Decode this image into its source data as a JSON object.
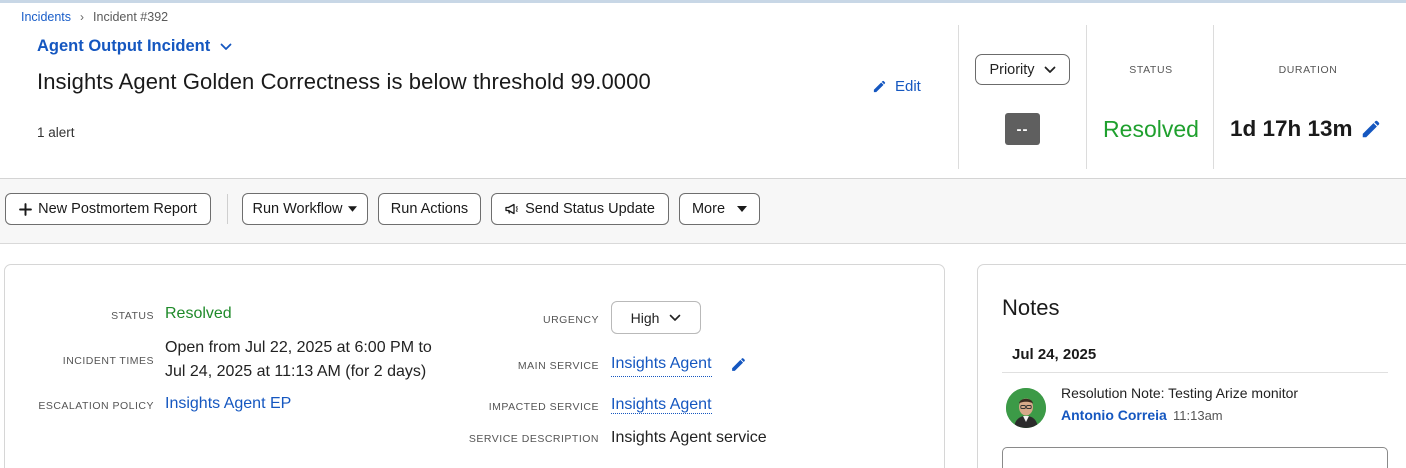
{
  "breadcrumb": {
    "root": "Incidents",
    "current": "Incident #392"
  },
  "incident": {
    "type": "Agent Output Incident",
    "title": "Insights Agent Golden Correctness is below threshold 99.0000",
    "alert_count": "1 alert",
    "edit_label": "Edit"
  },
  "stats": {
    "priority_label": "Priority",
    "priority_value": "--",
    "status_label": "STATUS",
    "status_value": "Resolved",
    "duration_label": "DURATION",
    "duration_value": "1d 17h 13m"
  },
  "toolbar": {
    "postmortem": "New Postmortem Report",
    "workflow": "Run Workflow",
    "actions": "Run Actions",
    "status_update": "Send Status Update",
    "more": "More"
  },
  "details": {
    "status_label": "STATUS",
    "status_value": "Resolved",
    "times_label": "INCIDENT TIMES",
    "times_line1": "Open from Jul 22, 2025 at 6:00 PM to",
    "times_line2": "Jul 24, 2025 at 11:13 AM (for 2 days)",
    "escalation_label": "ESCALATION POLICY",
    "escalation_value": "Insights Agent EP",
    "urgency_label": "URGENCY",
    "urgency_value": "High",
    "main_service_label": "MAIN SERVICE",
    "main_service_value": "Insights Agent",
    "impacted_label": "IMPACTED SERVICE",
    "impacted_value": "Insights Agent",
    "description_label": "SERVICE DESCRIPTION",
    "description_value": "Insights Agent service"
  },
  "notes": {
    "title": "Notes",
    "date": "Jul 24, 2025",
    "entries": [
      {
        "text": "Resolution Note: Testing Arize monitor",
        "author": "Antonio Correia",
        "time": "11:13am"
      }
    ]
  },
  "colors": {
    "link": "#1557c0",
    "resolved": "#1fa02e",
    "priority_badge": "#5f5f5f"
  }
}
